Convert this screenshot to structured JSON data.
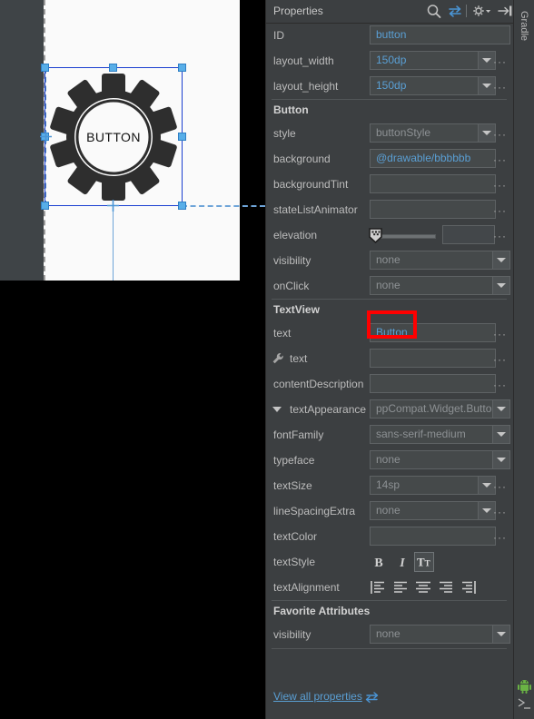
{
  "canvas": {
    "widget_label": "BUTTON",
    "widget_icon": "gear-shape"
  },
  "properties": {
    "header": {
      "title": "Properties",
      "icons": [
        "search-icon",
        "sort-toggle-icon",
        "gear-settings-icon",
        "collapse-panel-icon"
      ]
    },
    "rows": [
      {
        "type": "field",
        "label": "ID",
        "value": "button",
        "style": "plain",
        "ellipsis": false
      },
      {
        "type": "combo",
        "label": "layout_width",
        "value": "150dp",
        "style": "value",
        "ellipsis": true
      },
      {
        "type": "combo",
        "label": "layout_height",
        "value": "150dp",
        "style": "value",
        "ellipsis": true
      },
      {
        "type": "section",
        "label": "Button"
      },
      {
        "type": "combo",
        "label": "style",
        "value": "buttonStyle",
        "style": "muted",
        "ellipsis": true
      },
      {
        "type": "field",
        "label": "background",
        "value": "@drawable/bbbbbb",
        "style": "value",
        "ellipsis": true
      },
      {
        "type": "field",
        "label": "backgroundTint",
        "value": "",
        "style": "empty",
        "ellipsis": true
      },
      {
        "type": "field",
        "label": "stateListAnimator",
        "value": "",
        "style": "empty",
        "ellipsis": true
      },
      {
        "type": "slider",
        "label": "elevation",
        "value": "",
        "ellipsis": true
      },
      {
        "type": "combo",
        "label": "visibility",
        "value": "none",
        "style": "muted",
        "ellipsis": false
      },
      {
        "type": "combo",
        "label": "onClick",
        "value": "none",
        "style": "muted",
        "ellipsis": false
      },
      {
        "type": "section",
        "label": "TextView"
      },
      {
        "type": "field",
        "label": "text",
        "value": "Button",
        "style": "value",
        "ellipsis": true,
        "highlighted": true
      },
      {
        "type": "field",
        "label": "text",
        "value": "",
        "style": "empty",
        "ellipsis": true,
        "icon": "wrench-icon"
      },
      {
        "type": "field",
        "label": "contentDescription",
        "value": "",
        "style": "empty",
        "ellipsis": true
      },
      {
        "type": "combo",
        "label": "textAppearance",
        "value": "ppCompat.Widget.Button",
        "style": "muted",
        "ellipsis": false,
        "expander": true
      },
      {
        "type": "combo",
        "label": "fontFamily",
        "value": "sans-serif-medium",
        "style": "muted",
        "ellipsis": false
      },
      {
        "type": "combo",
        "label": "typeface",
        "value": "none",
        "style": "muted",
        "ellipsis": false
      },
      {
        "type": "combo",
        "label": "textSize",
        "value": "14sp",
        "style": "muted",
        "ellipsis": true
      },
      {
        "type": "combo",
        "label": "lineSpacingExtra",
        "value": "none",
        "style": "muted",
        "ellipsis": true
      },
      {
        "type": "field",
        "label": "textColor",
        "value": "",
        "style": "empty",
        "ellipsis": true
      },
      {
        "type": "style",
        "label": "textStyle",
        "buttons": [
          "bold-icon",
          "italic-icon",
          "all-caps-icon"
        ],
        "selected_index": 2
      },
      {
        "type": "align",
        "label": "textAlignment",
        "buttons": [
          "align-start-icon",
          "align-left-icon",
          "align-center-icon",
          "align-right-icon",
          "align-end-icon"
        ]
      },
      {
        "type": "section",
        "label": "Favorite Attributes"
      },
      {
        "type": "combo",
        "label": "visibility",
        "value": "none",
        "style": "muted",
        "ellipsis": false
      }
    ],
    "footer": {
      "view_all_label": "View all properties",
      "view_all_icon": "jump-to-source-icon"
    }
  },
  "right_strip": {
    "gradle_tab": "Gradle",
    "icons": [
      "android-robot-icon",
      "device-manager-icon"
    ]
  },
  "colors": {
    "panel_bg": "#3c3f41",
    "value_text": "#5a9fd4",
    "muted_text": "#8d9194",
    "selection": "#1a3fd0",
    "handle": "#58aee8",
    "highlight": "#ff0000",
    "android_green": "#6ab344"
  }
}
